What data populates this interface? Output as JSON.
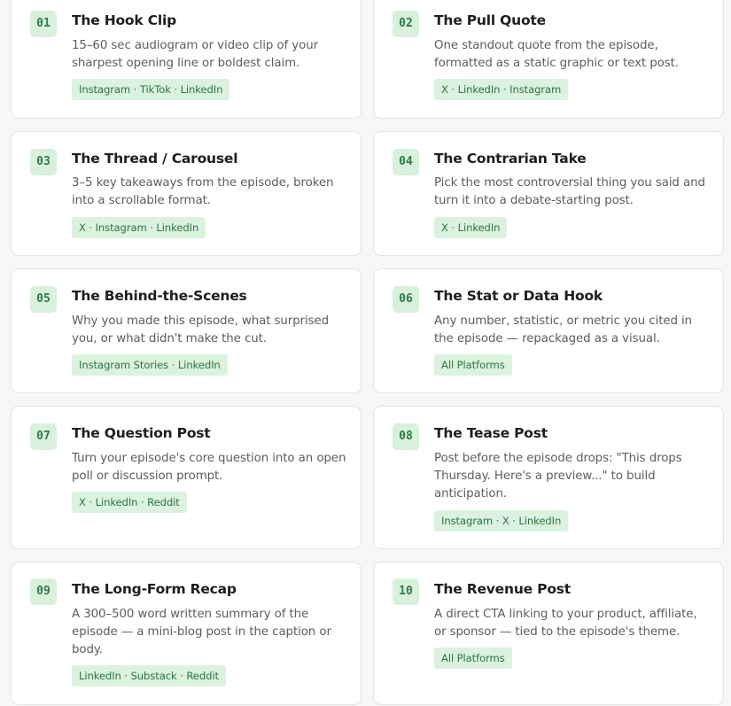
{
  "cards": [
    {
      "number": "01",
      "title": "The Hook Clip",
      "description": "15–60 sec audiogram or video clip of your sharpest opening line or boldest claim.",
      "platforms": "Instagram · TikTok · LinkedIn"
    },
    {
      "number": "02",
      "title": "The Pull Quote",
      "description": "One standout quote from the episode, formatted as a static graphic or text post.",
      "platforms": "X · LinkedIn · Instagram"
    },
    {
      "number": "03",
      "title": "The Thread / Carousel",
      "description": "3–5 key takeaways from the episode, broken into a scrollable format.",
      "platforms": "X · Instagram · LinkedIn"
    },
    {
      "number": "04",
      "title": "The Contrarian Take",
      "description": "Pick the most controversial thing you said and turn it into a debate-starting post.",
      "platforms": "X · LinkedIn"
    },
    {
      "number": "05",
      "title": "The Behind-the-Scenes",
      "description": "Why you made this episode, what surprised you, or what didn't make the cut.",
      "platforms": "Instagram Stories · LinkedIn"
    },
    {
      "number": "06",
      "title": "The Stat or Data Hook",
      "description": "Any number, statistic, or metric you cited in the episode — repackaged as a visual.",
      "platforms": "All Platforms"
    },
    {
      "number": "07",
      "title": "The Question Post",
      "description": "Turn your episode's core question into an open poll or discussion prompt.",
      "platforms": "X · LinkedIn · Reddit"
    },
    {
      "number": "08",
      "title": "The Tease Post",
      "description": "Post before the episode drops: \"This drops Thursday. Here's a preview...\" to build anticipation.",
      "platforms": "Instagram · X · LinkedIn"
    },
    {
      "number": "09",
      "title": "The Long-Form Recap",
      "description": "A 300–500 word written summary of the episode — a mini-blog post in the caption or body.",
      "platforms": "LinkedIn · Substack · Reddit"
    },
    {
      "number": "10",
      "title": "The Revenue Post",
      "description": "A direct CTA linking to your product, affiliate, or sponsor — tied to the episode's theme.",
      "platforms": "All Platforms"
    }
  ],
  "colors": {
    "page_background": "#f7f7f5",
    "card_background": "#ffffff",
    "card_border": "#e3e5e1",
    "badge_background": "#d8f0dc",
    "badge_text": "#2f7a45",
    "tag_background": "#dbf2df",
    "tag_text": "#2d7443"
  }
}
